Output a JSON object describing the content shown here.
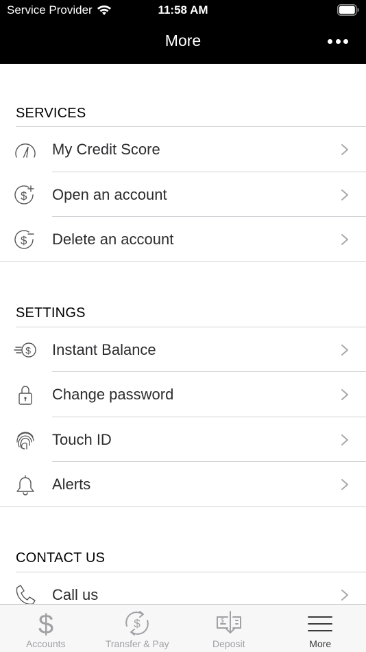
{
  "status_bar": {
    "carrier": "Service Provider",
    "time": "11:58 AM"
  },
  "nav": {
    "title": "More",
    "more_icon": "ellipsis-icon"
  },
  "sections": {
    "services": {
      "title": "SERVICES",
      "items": [
        {
          "label": "My Credit Score",
          "icon": "gauge-icon"
        },
        {
          "label": "Open an account",
          "icon": "dollar-plus-icon"
        },
        {
          "label": "Delete an account",
          "icon": "dollar-minus-icon"
        }
      ]
    },
    "settings": {
      "title": "SETTINGS",
      "items": [
        {
          "label": "Instant Balance",
          "icon": "fast-dollar-icon"
        },
        {
          "label": "Change password",
          "icon": "lock-icon"
        },
        {
          "label": "Touch ID",
          "icon": "fingerprint-icon"
        },
        {
          "label": "Alerts",
          "icon": "bell-icon"
        }
      ]
    },
    "contact": {
      "title": "CONTACT US",
      "items": [
        {
          "label": "Call us",
          "icon": "phone-icon"
        }
      ]
    }
  },
  "tabs": [
    {
      "label": "Accounts",
      "icon": "dollar-sign-icon"
    },
    {
      "label": "Transfer & Pay",
      "icon": "transfer-icon"
    },
    {
      "label": "Deposit",
      "icon": "check-deposit-icon"
    },
    {
      "label": "More",
      "icon": "menu-icon",
      "active": true
    }
  ],
  "colors": {
    "header_bg": "#000000",
    "text": "#2c2c2e",
    "divider": "#d1d1d6",
    "tab_inactive": "#a0a0a5",
    "tab_active": "#3a3a3c"
  }
}
